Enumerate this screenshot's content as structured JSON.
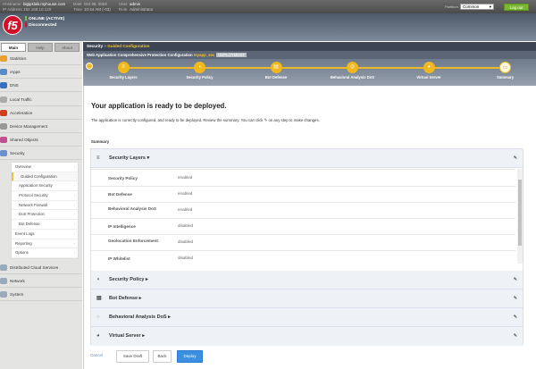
{
  "topbar": {
    "hostname_label": "Hostname",
    "hostname": "bigip1lab.myhouse.com",
    "ip_label": "IP Address",
    "ip": "192.168.10.120",
    "date_label": "Date",
    "date": "Oct 30, 2024",
    "time_label": "Time",
    "time": "10:44 AM (-03)",
    "user_label": "User",
    "user": "admin",
    "role_label": "Role",
    "role": "Administrator",
    "partition_label": "Partition:",
    "partition": "Common",
    "logout": "Log out"
  },
  "status": {
    "online": "ONLINE (ACTIVE)",
    "sync": "Disconnected",
    "online_color": "#7cc142",
    "sync_color": "#d0102a"
  },
  "logo": "f5",
  "tabs": [
    "Main",
    "Help",
    "About"
  ],
  "nav": [
    "Statistics",
    "iApps",
    "DNS",
    "Local Traffic",
    "Acceleration",
    "Device Management",
    "Shared Objects",
    "Security"
  ],
  "security_sub": [
    "Overview",
    "Guided Configuration",
    "Application Security",
    "Protocol Security",
    "Network Firewall",
    "DoS Protection",
    "Bot Defense",
    "Event Logs",
    "Reporting",
    "Options"
  ],
  "nav_bottom": [
    "Distributed Cloud Services",
    "Network",
    "System"
  ],
  "breadcrumb": {
    "root": "Security",
    "sep": "»",
    "current": "Guided Configuration"
  },
  "config": {
    "title": "Web Application Comprehensive Protection Configuration",
    "app": "myapp_sec",
    "tag": "DEPLOYMENT"
  },
  "steps": [
    "Security Layers",
    "Security Policy",
    "Bot Defense",
    "Behavioral Analysis DoS",
    "Virtual Server",
    "Summary"
  ],
  "main": {
    "title": "Your application is ready to be deployed.",
    "desc1": "The application is correctly configured, and ready to be deployed. Review the summary. You can click",
    "desc2": "on any step to make changes.",
    "summary": "Summary"
  },
  "sections": {
    "layers": "Security Layers",
    "policy": "Security Policy",
    "bot": "Bot Defense",
    "dos": "Behavioral Analysis DoS",
    "vs": "Virtual Server"
  },
  "layers": [
    {
      "name": "Security Policy",
      "value": "enabled"
    },
    {
      "name": "Bot Defense",
      "value": "enabled"
    },
    {
      "name": "Behavioral Analysis DoS",
      "value": "enabled"
    },
    {
      "name": "IP Intelligence",
      "value": "disabled"
    },
    {
      "name": "Geolocation Enforcement",
      "value": "disabled"
    },
    {
      "name": "IP Whitelist",
      "value": "disabled"
    }
  ],
  "buttons": {
    "cancel": "Cancel",
    "save": "Save Draft",
    "back": "Back",
    "deploy": "Deploy"
  }
}
